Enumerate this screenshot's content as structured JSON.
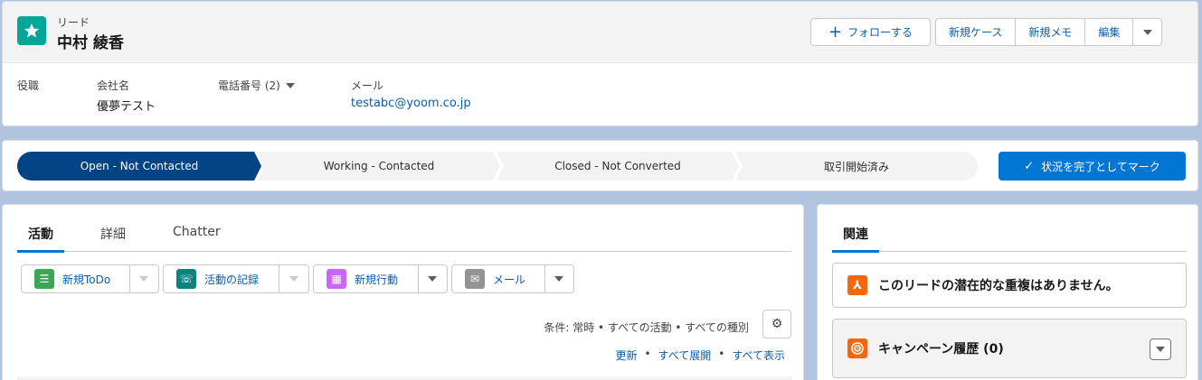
{
  "header": {
    "object_type": "リード",
    "record_name": "中村 綾香",
    "follow_label": "フォローする",
    "actions": [
      "新規ケース",
      "新規メモ",
      "編集"
    ],
    "fields": [
      {
        "label": "役職",
        "value": ""
      },
      {
        "label": "会社名",
        "value": "優夢テスト"
      },
      {
        "label": "電話番号 (2)",
        "value": ""
      },
      {
        "label": "メール",
        "value": "testabc@yoom.co.jp"
      }
    ]
  },
  "path": {
    "steps": [
      "Open - Not Contacted",
      "Working - Contacted",
      "Closed - Not Converted",
      "取引開始済み"
    ],
    "current_index": 0,
    "mark_button": "状況を完了としてマーク"
  },
  "activity": {
    "tabs": [
      "活動",
      "詳細",
      "Chatter"
    ],
    "active_tab": "活動",
    "publisher": [
      {
        "label": "新規ToDo",
        "icon": "task-icon",
        "color": "#3ba755",
        "dropdown_disabled": true
      },
      {
        "label": "活動の記録",
        "icon": "log-call-icon",
        "color": "#0b827c",
        "dropdown_disabled": true
      },
      {
        "label": "新規行動",
        "icon": "calendar-icon",
        "color": "#cb65ff",
        "dropdown_disabled": false
      },
      {
        "label": "メール",
        "icon": "email-icon",
        "color": "#939393",
        "dropdown_disabled": false
      }
    ],
    "filter_text": "条件: 常時 • すべての活動 • すべての種別",
    "links": [
      "更新",
      "すべて展開",
      "すべて表示"
    ]
  },
  "related": {
    "tab": "関連",
    "duplicate_text": "このリードの潜在的な重複はありません。",
    "campaign_title": "キャンペーン履歴 (0)"
  },
  "colors": {
    "brand": "#0176d3",
    "path_current": "#014486",
    "lead_icon": "#06a59a",
    "background": "#b0c4df"
  }
}
